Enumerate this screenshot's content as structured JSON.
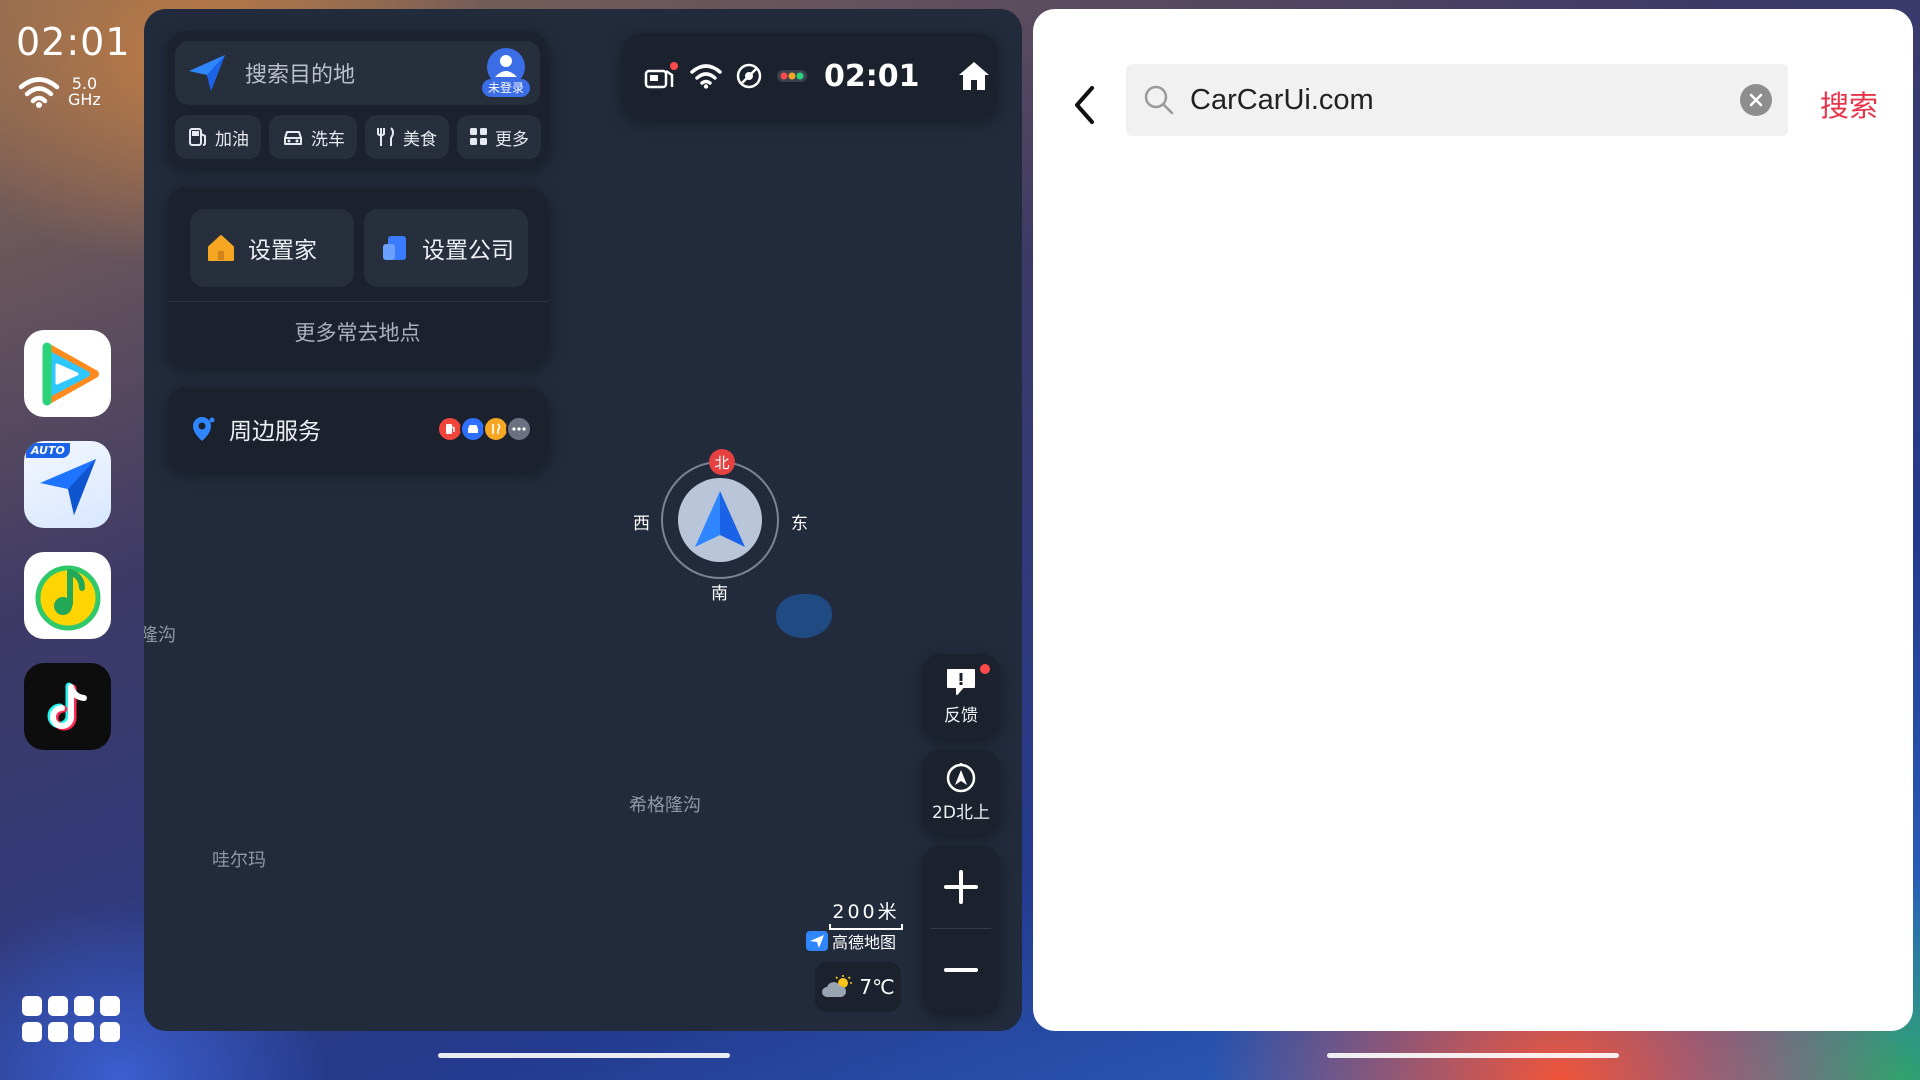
{
  "dock": {
    "time": "02:01",
    "wifi_band": "5.0",
    "wifi_unit": "GHz",
    "apps": [
      {
        "name": "video-app",
        "badge": ""
      },
      {
        "name": "map-app",
        "badge": "AUTO"
      },
      {
        "name": "music-app",
        "badge": ""
      },
      {
        "name": "tiktok-app",
        "badge": ""
      }
    ]
  },
  "map": {
    "search_placeholder": "搜索目的地",
    "login_badge": "未登录",
    "chips": [
      {
        "label": "加油",
        "icon": "fuel-icon"
      },
      {
        "label": "洗车",
        "icon": "car-wash-icon"
      },
      {
        "label": "美食",
        "icon": "food-icon"
      },
      {
        "label": "更多",
        "icon": "grid-icon"
      }
    ],
    "favorites": {
      "home": "设置家",
      "company": "设置公司",
      "more": "更多常去地点"
    },
    "nearby": {
      "label": "周边服务"
    },
    "status": {
      "time": "02:01"
    },
    "compass": {
      "north": "北",
      "south": "南",
      "east": "东",
      "west": "西"
    },
    "labels": {
      "left_edge": "隆沟",
      "xigelonggou": "希格隆沟",
      "waerma": "哇尔玛"
    },
    "controls": {
      "feedback": "反馈",
      "north_up": "2D北上"
    },
    "scale": "200米",
    "brand": "高德地图",
    "weather": "7℃"
  },
  "search": {
    "query": "CarCarUi.com",
    "submit_label": "搜索"
  },
  "colors": {
    "accent_red": "#e8334a",
    "map_bg": "#222b3b",
    "card_bg": "#1b212d"
  }
}
